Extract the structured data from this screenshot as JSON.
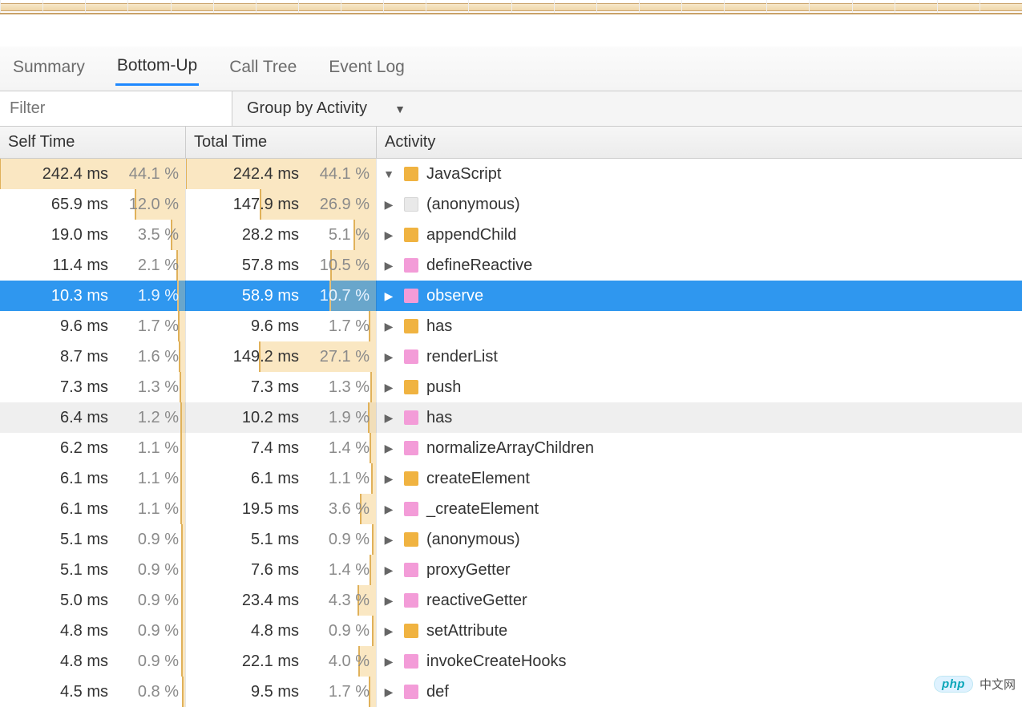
{
  "tabs": {
    "summary": "Summary",
    "bottom_up": "Bottom-Up",
    "call_tree": "Call Tree",
    "event_log": "Event Log",
    "active": "bottom_up"
  },
  "filter": {
    "placeholder": "Filter",
    "group_label": "Group by Activity"
  },
  "columns": {
    "self_time": "Self Time",
    "total_time": "Total Time",
    "activity": "Activity"
  },
  "colors": {
    "orange": "#f0b341",
    "pink": "#f39cd8",
    "grey": "#e9e9e9",
    "selection": "#2f97ef"
  },
  "watermark": {
    "brand": "php",
    "site": "中文网"
  },
  "rows": [
    {
      "self_ms": "242.4 ms",
      "self_pct": "44.1 %",
      "self_bar": 100,
      "total_ms": "242.4 ms",
      "total_pct": "44.1 %",
      "total_bar": 100,
      "indent": 0,
      "expanded": true,
      "swatch": "orange",
      "label": "JavaScript",
      "selected": false,
      "hover": false
    },
    {
      "self_ms": "65.9 ms",
      "self_pct": "12.0 %",
      "self_bar": 27.2,
      "total_ms": "147.9 ms",
      "total_pct": "26.9 %",
      "total_bar": 61.0,
      "indent": 1,
      "expanded": false,
      "swatch": "grey",
      "label": "(anonymous)",
      "selected": false,
      "hover": false
    },
    {
      "self_ms": "19.0 ms",
      "self_pct": "3.5 %",
      "self_bar": 7.9,
      "total_ms": "28.2 ms",
      "total_pct": "5.1 %",
      "total_bar": 11.6,
      "indent": 1,
      "expanded": false,
      "swatch": "orange",
      "label": "appendChild",
      "selected": false,
      "hover": false
    },
    {
      "self_ms": "11.4 ms",
      "self_pct": "2.1 %",
      "self_bar": 4.8,
      "total_ms": "57.8 ms",
      "total_pct": "10.5 %",
      "total_bar": 23.8,
      "indent": 1,
      "expanded": false,
      "swatch": "pink",
      "label": "defineReactive",
      "selected": false,
      "hover": false
    },
    {
      "self_ms": "10.3 ms",
      "self_pct": "1.9 %",
      "self_bar": 4.3,
      "total_ms": "58.9 ms",
      "total_pct": "10.7 %",
      "total_bar": 24.3,
      "indent": 1,
      "expanded": false,
      "swatch": "pink",
      "label": "observe",
      "selected": true,
      "hover": false
    },
    {
      "self_ms": "9.6 ms",
      "self_pct": "1.7 %",
      "self_bar": 3.9,
      "total_ms": "9.6 ms",
      "total_pct": "1.7 %",
      "total_bar": 3.9,
      "indent": 1,
      "expanded": false,
      "swatch": "orange",
      "label": "has",
      "selected": false,
      "hover": false
    },
    {
      "self_ms": "8.7 ms",
      "self_pct": "1.6 %",
      "self_bar": 3.6,
      "total_ms": "149.2 ms",
      "total_pct": "27.1 %",
      "total_bar": 61.5,
      "indent": 1,
      "expanded": false,
      "swatch": "pink",
      "label": "renderList",
      "selected": false,
      "hover": false
    },
    {
      "self_ms": "7.3 ms",
      "self_pct": "1.3 %",
      "self_bar": 2.9,
      "total_ms": "7.3 ms",
      "total_pct": "1.3 %",
      "total_bar": 2.9,
      "indent": 1,
      "expanded": false,
      "swatch": "orange",
      "label": "push",
      "selected": false,
      "hover": false
    },
    {
      "self_ms": "6.4 ms",
      "self_pct": "1.2 %",
      "self_bar": 2.7,
      "total_ms": "10.2 ms",
      "total_pct": "1.9 %",
      "total_bar": 4.3,
      "indent": 1,
      "expanded": false,
      "swatch": "pink",
      "label": "has",
      "selected": false,
      "hover": true
    },
    {
      "self_ms": "6.2 ms",
      "self_pct": "1.1 %",
      "self_bar": 2.5,
      "total_ms": "7.4 ms",
      "total_pct": "1.4 %",
      "total_bar": 3.2,
      "indent": 1,
      "expanded": false,
      "swatch": "pink",
      "label": "normalizeArrayChildren",
      "selected": false,
      "hover": false
    },
    {
      "self_ms": "6.1 ms",
      "self_pct": "1.1 %",
      "self_bar": 2.5,
      "total_ms": "6.1 ms",
      "total_pct": "1.1 %",
      "total_bar": 2.5,
      "indent": 1,
      "expanded": false,
      "swatch": "orange",
      "label": "createElement",
      "selected": false,
      "hover": false
    },
    {
      "self_ms": "6.1 ms",
      "self_pct": "1.1 %",
      "self_bar": 2.5,
      "total_ms": "19.5 ms",
      "total_pct": "3.6 %",
      "total_bar": 8.2,
      "indent": 1,
      "expanded": false,
      "swatch": "pink",
      "label": "_createElement",
      "selected": false,
      "hover": false
    },
    {
      "self_ms": "5.1 ms",
      "self_pct": "0.9 %",
      "self_bar": 2.0,
      "total_ms": "5.1 ms",
      "total_pct": "0.9 %",
      "total_bar": 2.0,
      "indent": 1,
      "expanded": false,
      "swatch": "orange",
      "label": "(anonymous)",
      "selected": false,
      "hover": false
    },
    {
      "self_ms": "5.1 ms",
      "self_pct": "0.9 %",
      "self_bar": 2.0,
      "total_ms": "7.6 ms",
      "total_pct": "1.4 %",
      "total_bar": 3.2,
      "indent": 1,
      "expanded": false,
      "swatch": "pink",
      "label": "proxyGetter",
      "selected": false,
      "hover": false
    },
    {
      "self_ms": "5.0 ms",
      "self_pct": "0.9 %",
      "self_bar": 2.0,
      "total_ms": "23.4 ms",
      "total_pct": "4.3 %",
      "total_bar": 9.8,
      "indent": 1,
      "expanded": false,
      "swatch": "pink",
      "label": "reactiveGetter",
      "selected": false,
      "hover": false
    },
    {
      "self_ms": "4.8 ms",
      "self_pct": "0.9 %",
      "self_bar": 2.0,
      "total_ms": "4.8 ms",
      "total_pct": "0.9 %",
      "total_bar": 2.0,
      "indent": 1,
      "expanded": false,
      "swatch": "orange",
      "label": "setAttribute",
      "selected": false,
      "hover": false
    },
    {
      "self_ms": "4.8 ms",
      "self_pct": "0.9 %",
      "self_bar": 2.0,
      "total_ms": "22.1 ms",
      "total_pct": "4.0 %",
      "total_bar": 9.1,
      "indent": 1,
      "expanded": false,
      "swatch": "pink",
      "label": "invokeCreateHooks",
      "selected": false,
      "hover": false
    },
    {
      "self_ms": "4.5 ms",
      "self_pct": "0.8 %",
      "self_bar": 1.8,
      "total_ms": "9.5 ms",
      "total_pct": "1.7 %",
      "total_bar": 3.9,
      "indent": 1,
      "expanded": false,
      "swatch": "pink",
      "label": "def",
      "selected": false,
      "hover": false
    }
  ]
}
